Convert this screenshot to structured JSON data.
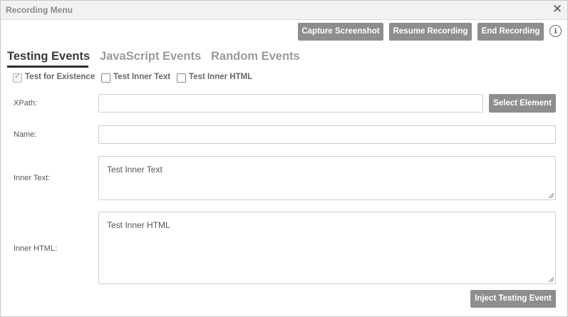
{
  "window": {
    "title": "Recording Menu",
    "close_glyph": "✕"
  },
  "toolbar": {
    "capture_label": "Capture Screenshot",
    "resume_label": "Resume Recording",
    "end_label": "End Recording",
    "info_glyph": "i"
  },
  "tabs": [
    {
      "label": "Testing Events",
      "active": true
    },
    {
      "label": "JavaScript Events",
      "active": false
    },
    {
      "label": "Random Events",
      "active": false
    }
  ],
  "options": [
    {
      "label": "Test for Existence",
      "checked": true,
      "disabled": true
    },
    {
      "label": "Test Inner Text",
      "checked": false,
      "disabled": false
    },
    {
      "label": "Test Inner HTML",
      "checked": false,
      "disabled": false
    }
  ],
  "form": {
    "xpath_label": "XPath:",
    "xpath_value": "",
    "select_element_label": "Select Element",
    "name_label": "Name:",
    "name_value": "",
    "inner_text_label": "Inner Text:",
    "inner_text_value": "Test Inner Text",
    "inner_html_label": "Inner HTML:",
    "inner_html_value": "Test Inner HTML",
    "inject_label": "Inject Testing Event"
  },
  "colors": {
    "button_bg": "#8e8e8e",
    "active_tab": "#3a3a3a",
    "inactive_tab": "#9a9a9a"
  },
  "icons": [
    "close-icon",
    "info-icon",
    "check-icon",
    "resize-grip-icon"
  ]
}
